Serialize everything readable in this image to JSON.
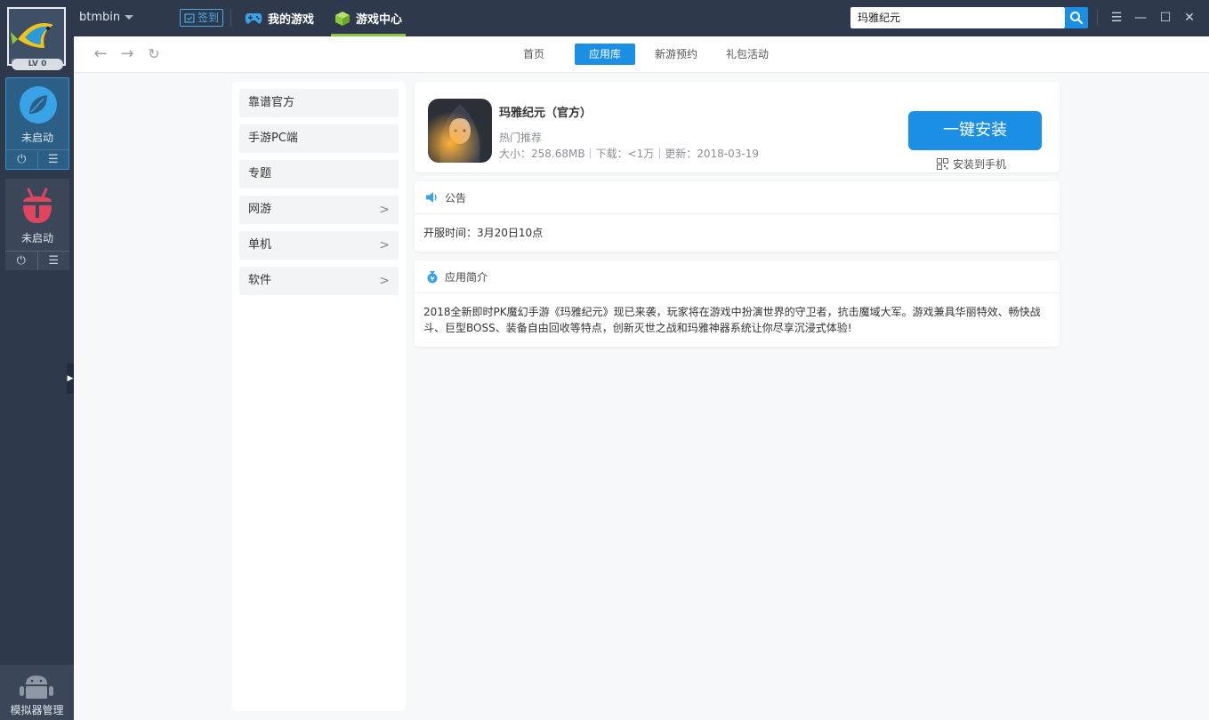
{
  "sidebar": {
    "level_badge": "LV 0",
    "emulators": [
      {
        "status": "未启动",
        "color": "#3aa3e8"
      },
      {
        "status": "未启动",
        "color": "#e0455f"
      }
    ],
    "manager_label": "模拟器管理"
  },
  "topbar": {
    "username": "btmbin",
    "signin_label": "签到",
    "tab_my_games": "我的游戏",
    "tab_game_center": "游戏中心",
    "search_value": "玛雅纪元"
  },
  "nav": {
    "tabs": [
      "首页",
      "应用库",
      "新游预约",
      "礼包活动"
    ],
    "active": "应用库"
  },
  "categories": [
    {
      "label": "靠谱官方",
      "has_arrow": false
    },
    {
      "label": "手游PC端",
      "has_arrow": false
    },
    {
      "label": "专题",
      "has_arrow": false
    },
    {
      "label": "网游",
      "has_arrow": true
    },
    {
      "label": "单机",
      "has_arrow": true
    },
    {
      "label": "软件",
      "has_arrow": true
    }
  ],
  "app": {
    "title": "玛雅纪元（官方）",
    "tag": "热门推荐",
    "meta": "大小：258.68MB｜下载：<1万｜更新：2018-03-19",
    "install_label": "一键安装",
    "install_phone_label": "安装到手机"
  },
  "notice": {
    "title": "公告",
    "text": "开服时间：3月20日10点"
  },
  "intro": {
    "title": "应用简介",
    "text": "2018全新即时PK魔幻手游《玛雅纪元》现已来袭，玩家将在游戏中扮演世界的守卫者，抗击魔域大军。游戏兼具华丽特效、畅快战斗、巨型BOSS、装备自由回收等特点，创新灭世之战和玛雅神器系统让你尽享沉浸式体验!"
  },
  "colors": {
    "accent": "#1a8fe3",
    "green": "#8dc63f",
    "dark": "#2e3a4c"
  }
}
